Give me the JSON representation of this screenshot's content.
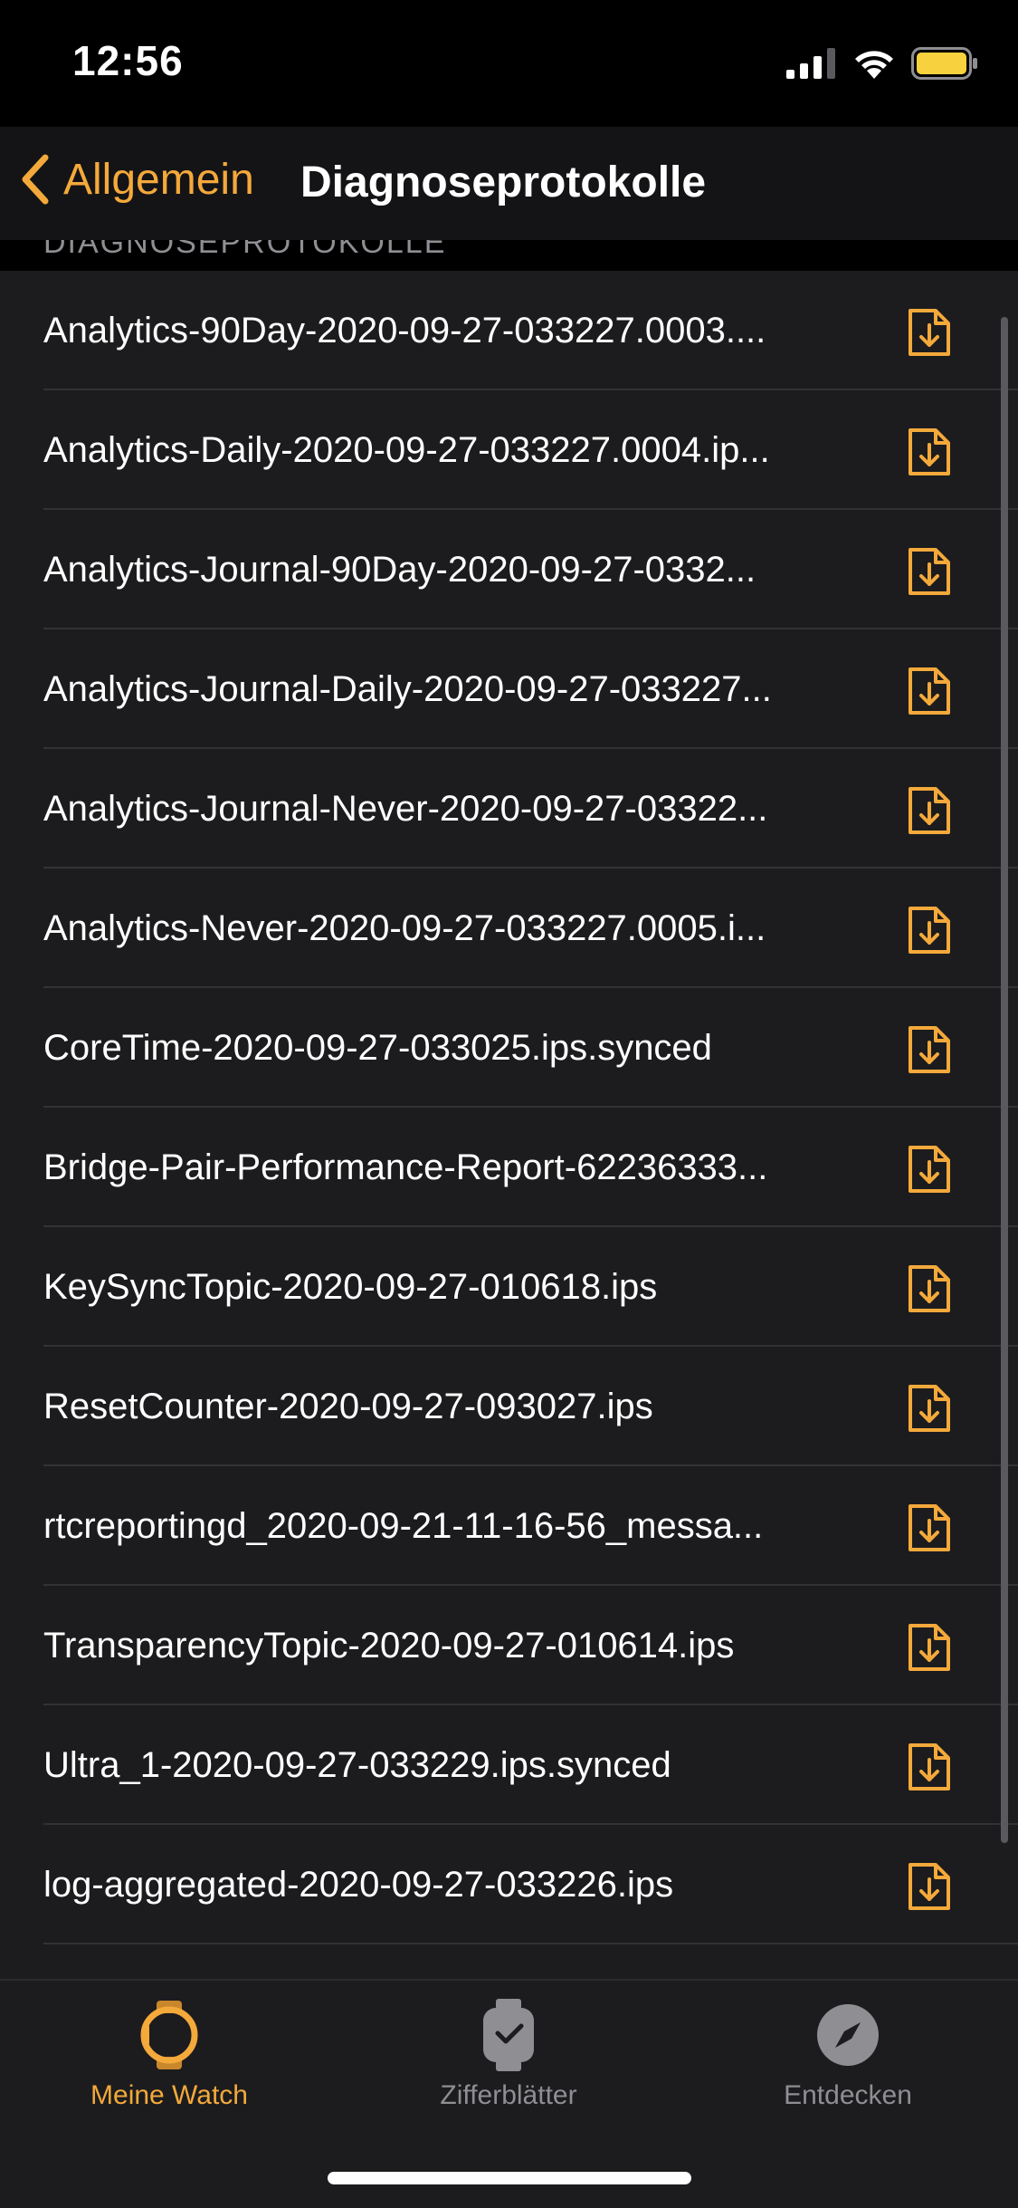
{
  "status": {
    "time": "12:56"
  },
  "nav": {
    "back_label": "Allgemein",
    "title": "Diagnoseprotokolle"
  },
  "section": {
    "header": "DIAGNOSEPROTOKOLLE"
  },
  "logs": [
    "Analytics-90Day-2020-09-27-033227.0003....",
    "Analytics-Daily-2020-09-27-033227.0004.ip...",
    "Analytics-Journal-90Day-2020-09-27-0332...",
    "Analytics-Journal-Daily-2020-09-27-033227...",
    "Analytics-Journal-Never-2020-09-27-03322...",
    "Analytics-Never-2020-09-27-033227.0005.i...",
    "CoreTime-2020-09-27-033025.ips.synced",
    "Bridge-Pair-Performance-Report-62236333...",
    "KeySyncTopic-2020-09-27-010618.ips",
    "ResetCounter-2020-09-27-093027.ips",
    "rtcreportingd_2020-09-21-11-16-56_messa...",
    "TransparencyTopic-2020-09-27-010614.ips",
    "Ultra_1-2020-09-27-033229.ips.synced",
    "log-aggregated-2020-09-27-033226.ips"
  ],
  "tabs": [
    {
      "label": "Meine Watch",
      "active": true
    },
    {
      "label": "Zifferblätter",
      "active": false
    },
    {
      "label": "Entdecken",
      "active": false
    }
  ],
  "colors": {
    "accent": "#f4a93b",
    "inactive": "#8e8e93",
    "battery": "#f7d23e"
  }
}
